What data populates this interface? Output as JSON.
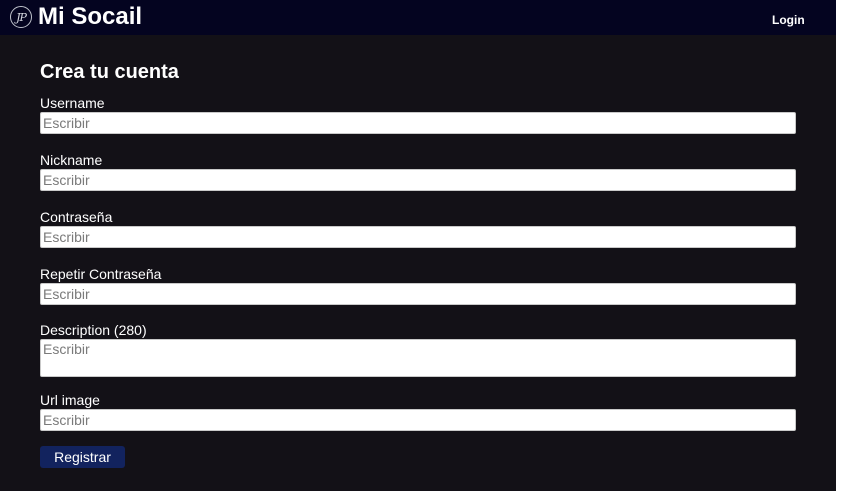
{
  "navbar": {
    "logo_text": "JP",
    "brand": "Mi Socail",
    "login": "Login"
  },
  "form": {
    "title": "Crea tu cuenta",
    "username_label": "Username",
    "username_placeholder": "Escribir",
    "nickname_label": "Nickname",
    "nickname_placeholder": "Escribir",
    "password_label": "Contraseña",
    "password_placeholder": "Escribir",
    "repeat_password_label": "Repetir Contraseña",
    "repeat_password_placeholder": "Escribir",
    "description_label": "Description (280)",
    "description_placeholder": "Escribir",
    "url_image_label": "Url image",
    "url_image_placeholder": "Escribir",
    "submit_label": "Registrar"
  },
  "colors": {
    "page_background": "#131117",
    "navbar_background": "#040420",
    "button_background": "#12235e"
  }
}
